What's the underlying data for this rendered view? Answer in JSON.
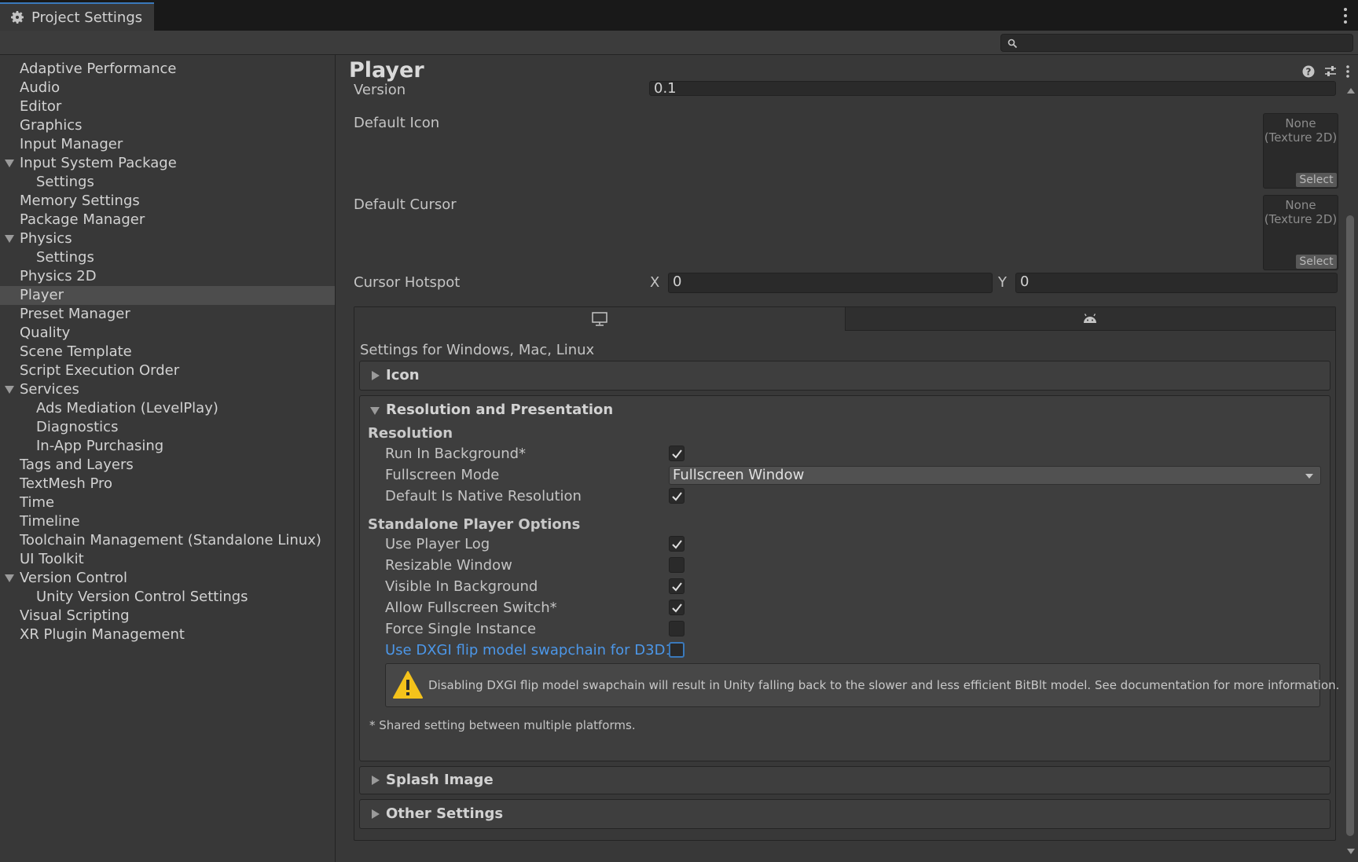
{
  "window": {
    "tab_title": "Project Settings",
    "search_placeholder": ""
  },
  "sidebar": {
    "items": [
      {
        "label": "Adaptive Performance"
      },
      {
        "label": "Audio"
      },
      {
        "label": "Editor"
      },
      {
        "label": "Graphics"
      },
      {
        "label": "Input Manager"
      },
      {
        "label": "Input System Package"
      },
      {
        "label": "Settings"
      },
      {
        "label": "Memory Settings"
      },
      {
        "label": "Package Manager"
      },
      {
        "label": "Physics"
      },
      {
        "label": "Settings"
      },
      {
        "label": "Physics 2D"
      },
      {
        "label": "Player"
      },
      {
        "label": "Preset Manager"
      },
      {
        "label": "Quality"
      },
      {
        "label": "Scene Template"
      },
      {
        "label": "Script Execution Order"
      },
      {
        "label": "Services"
      },
      {
        "label": "Ads Mediation (LevelPlay)"
      },
      {
        "label": "Diagnostics"
      },
      {
        "label": "In-App Purchasing"
      },
      {
        "label": "Tags and Layers"
      },
      {
        "label": "TextMesh Pro"
      },
      {
        "label": "Time"
      },
      {
        "label": "Timeline"
      },
      {
        "label": "Toolchain Management (Standalone Linux)"
      },
      {
        "label": "UI Toolkit"
      },
      {
        "label": "Version Control"
      },
      {
        "label": "Unity Version Control Settings"
      },
      {
        "label": "Visual Scripting"
      },
      {
        "label": "XR Plugin Management"
      }
    ]
  },
  "main": {
    "title": "Player",
    "version_label": "Version",
    "version_value": "0.1",
    "default_icon_label": "Default Icon",
    "default_cursor_label": "Default Cursor",
    "object_field_none": "None",
    "object_field_type": "(Texture 2D)",
    "select_label": "Select",
    "cursor_hotspot_label": "Cursor Hotspot",
    "hotspot_x_label": "X",
    "hotspot_x_value": "0",
    "hotspot_y_label": "Y",
    "hotspot_y_value": "0",
    "platform_settings_title": "Settings for Windows, Mac, Linux",
    "sections": {
      "icon": "Icon",
      "resolution_presentation": "Resolution and Presentation",
      "splash_image": "Splash Image",
      "other_settings": "Other Settings"
    },
    "resolution": {
      "heading": "Resolution",
      "run_in_background": "Run In Background*",
      "fullscreen_mode": "Fullscreen Mode",
      "fullscreen_mode_value": "Fullscreen Window",
      "default_native_resolution": "Default Is Native Resolution"
    },
    "standalone": {
      "heading": "Standalone Player Options",
      "use_player_log": "Use Player Log",
      "resizable_window": "Resizable Window",
      "visible_in_background": "Visible In Background",
      "allow_fullscreen_switch": "Allow Fullscreen Switch*",
      "force_single_instance": "Force Single Instance",
      "dxgi_flip": "Use DXGI flip model swapchain for D3D11"
    },
    "warning": "Disabling DXGI flip model swapchain will result in Unity falling back to the slower and less efficient BitBlt model. See documentation for more information.",
    "footnote": "* Shared setting between multiple platforms."
  }
}
